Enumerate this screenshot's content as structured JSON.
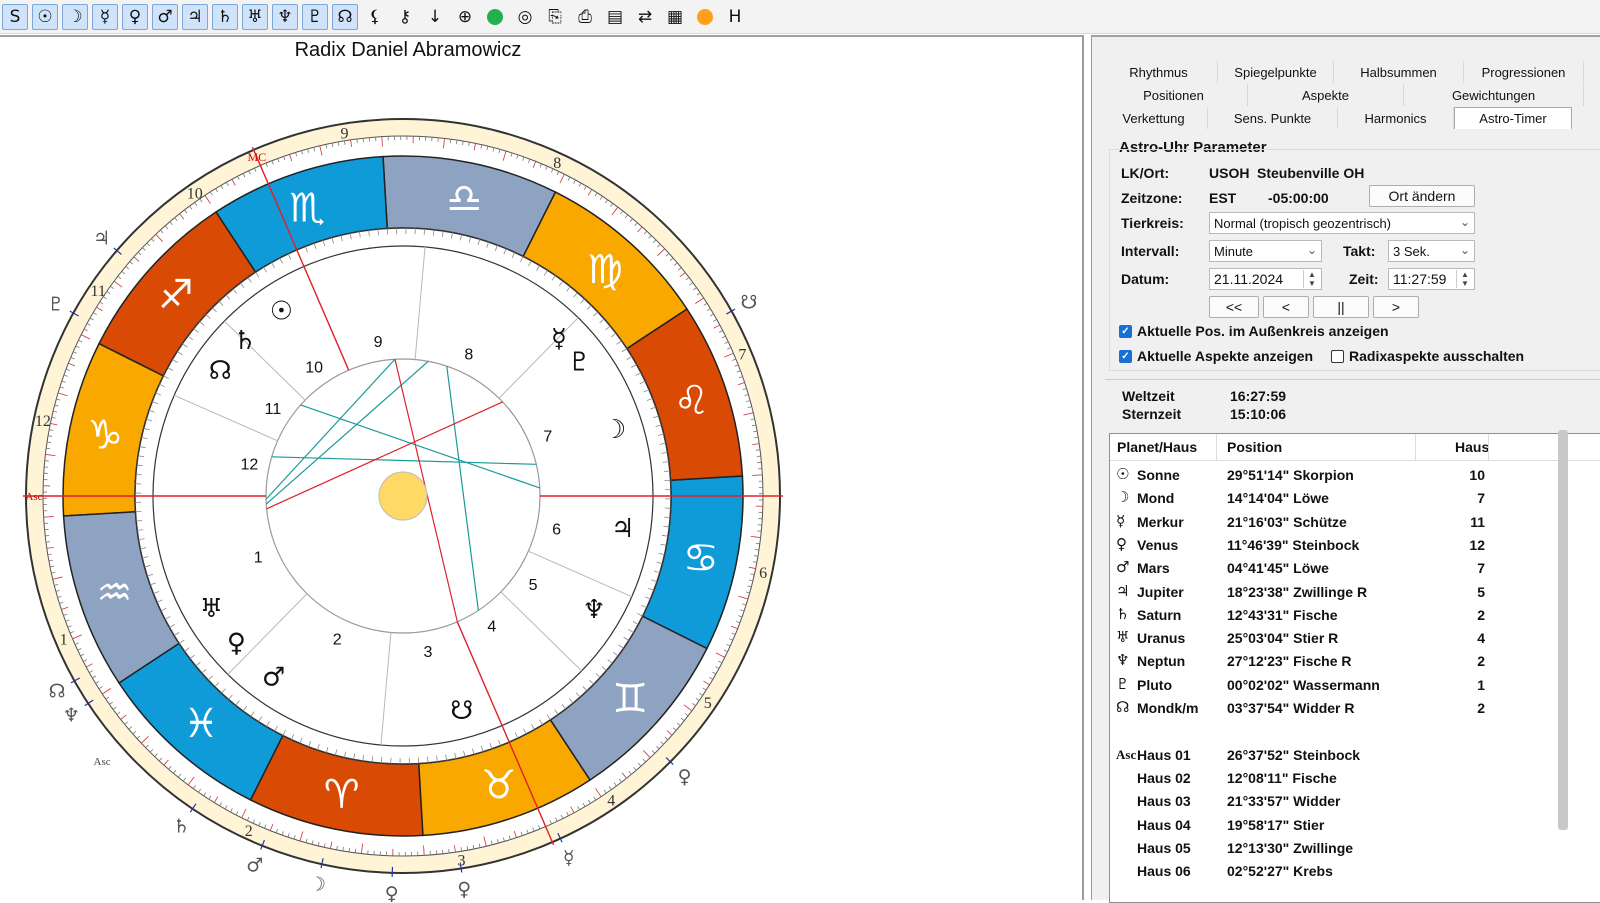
{
  "toolbar": {
    "items": [
      {
        "id": "s",
        "glyph": "S",
        "selected": true
      },
      {
        "id": "sun",
        "glyph": "☉",
        "selected": true
      },
      {
        "id": "moon",
        "glyph": "☽",
        "selected": true
      },
      {
        "id": "mercury",
        "glyph": "☿",
        "selected": true
      },
      {
        "id": "venus",
        "glyph": "♀",
        "selected": true
      },
      {
        "id": "mars",
        "glyph": "♂",
        "selected": true
      },
      {
        "id": "jupiter",
        "glyph": "♃",
        "selected": true
      },
      {
        "id": "saturn",
        "glyph": "♄",
        "selected": true
      },
      {
        "id": "uranus",
        "glyph": "♅",
        "selected": true
      },
      {
        "id": "neptune",
        "glyph": "♆",
        "selected": true
      },
      {
        "id": "pluto",
        "glyph": "♇",
        "selected": true
      },
      {
        "id": "node",
        "glyph": "☊",
        "selected": true
      },
      {
        "id": "lilith",
        "glyph": "⚸",
        "selected": false
      },
      {
        "id": "chiron",
        "glyph": "⚷",
        "selected": false
      },
      {
        "id": "arrow-down",
        "glyph": "↓",
        "selected": false
      },
      {
        "id": "earth",
        "glyph": "⊕",
        "selected": false
      },
      {
        "id": "green-dot",
        "glyph": "",
        "selected": false
      },
      {
        "id": "target",
        "glyph": "◎",
        "selected": false
      },
      {
        "id": "copy",
        "glyph": "⎘",
        "selected": false
      },
      {
        "id": "print",
        "glyph": "⎙",
        "selected": false
      },
      {
        "id": "doc",
        "glyph": "▤",
        "selected": false
      },
      {
        "id": "export",
        "glyph": "⇄",
        "selected": false
      },
      {
        "id": "pdf",
        "glyph": "▦",
        "selected": false
      },
      {
        "id": "orange-dot",
        "glyph": "",
        "selected": false
      },
      {
        "id": "h",
        "glyph": "H",
        "selected": false
      }
    ],
    "colors": {
      "green": "#22b14c",
      "orange": "#ff9f1a",
      "select": "#cfe4fb"
    }
  },
  "chart": {
    "title": "Radix Daniel Abramowicz",
    "signs": [
      {
        "glyph": "♑",
        "color": "#f9a800"
      },
      {
        "glyph": "♒",
        "color": "#8ea3c2"
      },
      {
        "glyph": "♓",
        "color": "#0f9ad8"
      },
      {
        "glyph": "♈",
        "color": "#d94a05"
      },
      {
        "glyph": "♉",
        "color": "#f9a800"
      },
      {
        "glyph": "♊",
        "color": "#8ea3c2"
      },
      {
        "glyph": "♋",
        "color": "#0f9ad8"
      },
      {
        "glyph": "♌",
        "color": "#d94a05"
      },
      {
        "glyph": "♍",
        "color": "#f9a800"
      },
      {
        "glyph": "♎",
        "color": "#8ea3c2"
      },
      {
        "glyph": "♏",
        "color": "#0f9ad8"
      },
      {
        "glyph": "♐",
        "color": "#d94a05"
      }
    ],
    "outer_house_numbers": [
      "1",
      "2",
      "3",
      "4",
      "5",
      "6",
      "7",
      "8",
      "9",
      "10",
      "11",
      "12"
    ],
    "inner_house_numbers": [
      "1",
      "2",
      "3",
      "4",
      "5",
      "6",
      "7",
      "8",
      "9",
      "10",
      "11",
      "12"
    ],
    "asc_label": "Asc",
    "mc_label": "MC",
    "desc_label": "Asc",
    "natal_planets": [
      {
        "glyph": "☉",
        "lon": 239.85
      },
      {
        "glyph": "♄",
        "lon": 252.0
      },
      {
        "glyph": "☊",
        "lon": 262.0
      },
      {
        "glyph": "♅",
        "lon": 327.0
      },
      {
        "glyph": "♀",
        "lon": 338.0
      },
      {
        "glyph": "♂",
        "lon": 351.0
      },
      {
        "glyph": "♇",
        "lon": 154.0
      },
      {
        "glyph": "☿",
        "lon": 162.0
      },
      {
        "glyph": "☽",
        "lon": 134.23
      },
      {
        "glyph": "♃",
        "lon": 108.4
      },
      {
        "glyph": "♆",
        "lon": 86.0
      },
      {
        "glyph": "☋",
        "lon": 42.0
      }
    ],
    "transit_planets": [
      {
        "glyph": "♃",
        "lon": 256.0,
        "retro": true
      },
      {
        "glyph": "♇",
        "lon": 267.6,
        "retro": true
      },
      {
        "glyph": "☊",
        "lon": 326.0,
        "retro": false
      },
      {
        "glyph": "♆",
        "lon": 330.0,
        "retro": true
      },
      {
        "glyph": "♄",
        "lon": 352.7,
        "retro": false
      },
      {
        "glyph": "♀",
        "lon": 71.8,
        "retro": false
      },
      {
        "glyph": "☿",
        "lon": 51.3,
        "retro": false
      },
      {
        "glyph": "☽",
        "lon": 14.2,
        "retro": false
      },
      {
        "glyph": "♂",
        "lon": 4.7,
        "retro": false
      },
      {
        "glyph": "♀",
        "lon": 35.5,
        "retro": false
      },
      {
        "glyph": "☋",
        "lon": 146.0,
        "retro": false
      },
      {
        "glyph": "♀",
        "lon": 25.0,
        "retro": false
      }
    ],
    "ring_colors": {
      "zodiac_border": "#222",
      "outer_bg": "#fff4d6",
      "inner_bg": "#ffffff",
      "sun_fill": "#ffd966",
      "red_line": "#e0202a",
      "aspect": "#1a9a9a",
      "house_line": "#b8b8b8"
    }
  },
  "tabs": {
    "row1": [
      "Rhythmus",
      "Spiegelpunkte",
      "Halbsummen",
      "Progressionen"
    ],
    "row2": [
      "Positionen",
      "Aspekte",
      "Gewichtungen"
    ],
    "row3": [
      "Verkettung",
      "Sens. Punkte",
      "Harmonics",
      "Astro-Timer"
    ],
    "active": "Astro-Timer"
  },
  "params": {
    "group_title": "Astro-Uhr Parameter",
    "lk_label": "LK/Ort:",
    "lk_code": "USOH",
    "lk_city": "Steubenville OH",
    "tz_label": "Zeitzone:",
    "tz_code": "EST",
    "tz_offset": "-05:00:00",
    "ort_button": "Ort ändern",
    "tierkreis_label": "Tierkreis:",
    "tierkreis_value": "Normal (tropisch geozentrisch)",
    "intervall_label": "Intervall:",
    "intervall_value": "Minute",
    "takt_label": "Takt:",
    "takt_value": "3 Sek.",
    "datum_label": "Datum:",
    "datum_value": "21.11.2024",
    "zeit_label": "Zeit:",
    "zeit_value": "11:27:59",
    "nav_buttons": [
      "<<",
      "<",
      "||",
      ">"
    ],
    "cb_outer": "Aktuelle Pos. im Außenkreis anzeigen",
    "cb_outer_checked": true,
    "cb_aspects": "Aktuelle Aspekte anzeigen",
    "cb_aspects_checked": true,
    "cb_radix": "Radixaspekte ausschalten",
    "cb_radix_checked": false,
    "weltzeit_label": "Weltzeit",
    "weltzeit_value": "16:27:59",
    "sternzeit_label": "Sternzeit",
    "sternzeit_value": "15:10:06"
  },
  "table": {
    "headers": [
      "Planet/Haus",
      "Position",
      "Haus"
    ],
    "rows": [
      {
        "sym": "☉",
        "name": "Sonne",
        "pos": "29°51'14\" Skorpion",
        "house": "10"
      },
      {
        "sym": "☽",
        "name": "Mond",
        "pos": "14°14'04\" Löwe",
        "house": "7"
      },
      {
        "sym": "☿",
        "name": "Merkur",
        "pos": "21°16'03\" Schütze",
        "house": "11"
      },
      {
        "sym": "♀",
        "name": "Venus",
        "pos": "11°46'39\" Steinbock",
        "house": "12"
      },
      {
        "sym": "♂",
        "name": "Mars",
        "pos": "04°41'45\" Löwe",
        "house": "7"
      },
      {
        "sym": "♃",
        "name": "Jupiter",
        "pos": "18°23'38\" Zwillinge R",
        "house": "5"
      },
      {
        "sym": "♄",
        "name": "Saturn",
        "pos": "12°43'31\" Fische",
        "house": "2"
      },
      {
        "sym": "♅",
        "name": "Uranus",
        "pos": "25°03'04\" Stier R",
        "house": "4"
      },
      {
        "sym": "♆",
        "name": "Neptun",
        "pos": "27°12'23\" Fische R",
        "house": "2"
      },
      {
        "sym": "♇",
        "name": "Pluto",
        "pos": "00°02'02\" Wassermann",
        "house": "1"
      },
      {
        "sym": "☊",
        "name": "Mondk/m",
        "pos": "03°37'54\" Widder R",
        "house": "2"
      },
      {
        "sym": "",
        "name": "",
        "pos": "",
        "house": ""
      },
      {
        "sym": "Asc",
        "name": "Haus 01",
        "pos": "26°37'52\" Steinbock",
        "house": ""
      },
      {
        "sym": "",
        "name": "Haus 02",
        "pos": "12°08'11\" Fische",
        "house": ""
      },
      {
        "sym": "",
        "name": "Haus 03",
        "pos": "21°33'57\" Widder",
        "house": ""
      },
      {
        "sym": "",
        "name": "Haus 04",
        "pos": "19°58'17\" Stier",
        "house": ""
      },
      {
        "sym": "",
        "name": "Haus 05",
        "pos": "12°13'30\" Zwillinge",
        "house": ""
      },
      {
        "sym": "",
        "name": "Haus 06",
        "pos": "02°52'27\" Krebs",
        "house": ""
      }
    ]
  }
}
